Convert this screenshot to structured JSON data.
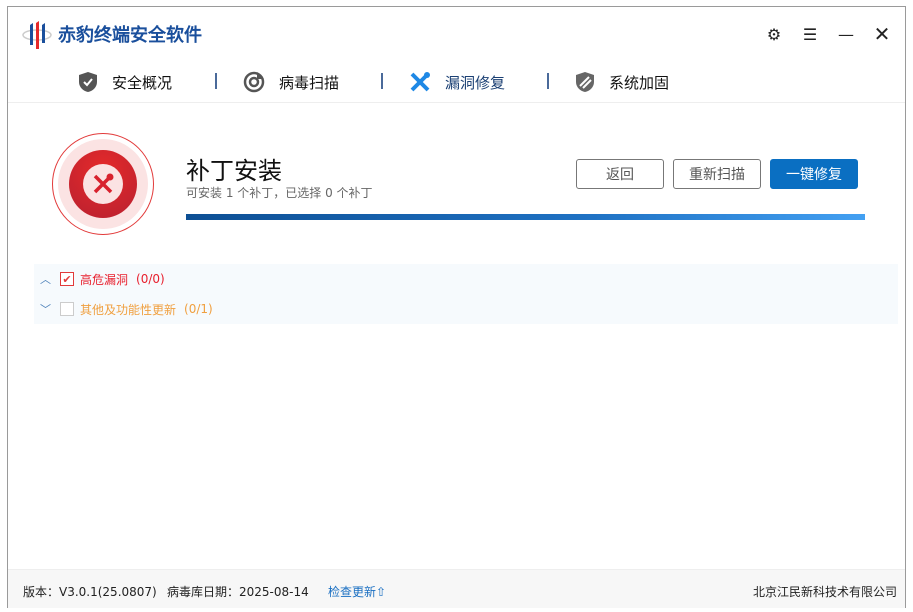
{
  "app": {
    "title": "赤豹终端安全软件"
  },
  "window_controls": {
    "settings": "gear-icon",
    "menu": "menu-icon",
    "minimize": "minimize-icon",
    "close": "close-icon"
  },
  "nav": [
    {
      "label": "安全概况",
      "icon": "shield-check-icon"
    },
    {
      "label": "病毒扫描",
      "icon": "scan-icon"
    },
    {
      "label": "漏洞修复",
      "icon": "wrench-icon",
      "active": true
    },
    {
      "label": "系统加固",
      "icon": "shield-stripe-icon"
    }
  ],
  "main": {
    "title": "补丁安装",
    "subtitle": "可安装 1 个补丁，已选择 0 个补丁",
    "progress": 100,
    "buttons": {
      "back": "返回",
      "rescan": "重新扫描",
      "fix": "一键修复"
    }
  },
  "groups": [
    {
      "label": "高危漏洞",
      "count": "(0/0)",
      "checked": true,
      "expanded": true,
      "color": "#e8202e"
    },
    {
      "label": "其他及功能性更新",
      "count": "(0/1)",
      "checked": false,
      "expanded": false,
      "color": "#f0a040"
    }
  ],
  "footer": {
    "version": "版本：V3.0.1(25.0807)",
    "db_date": "病毒库日期：2025-08-14",
    "check_update": "检查更新",
    "company": "北京江民新科技术有限公司"
  }
}
